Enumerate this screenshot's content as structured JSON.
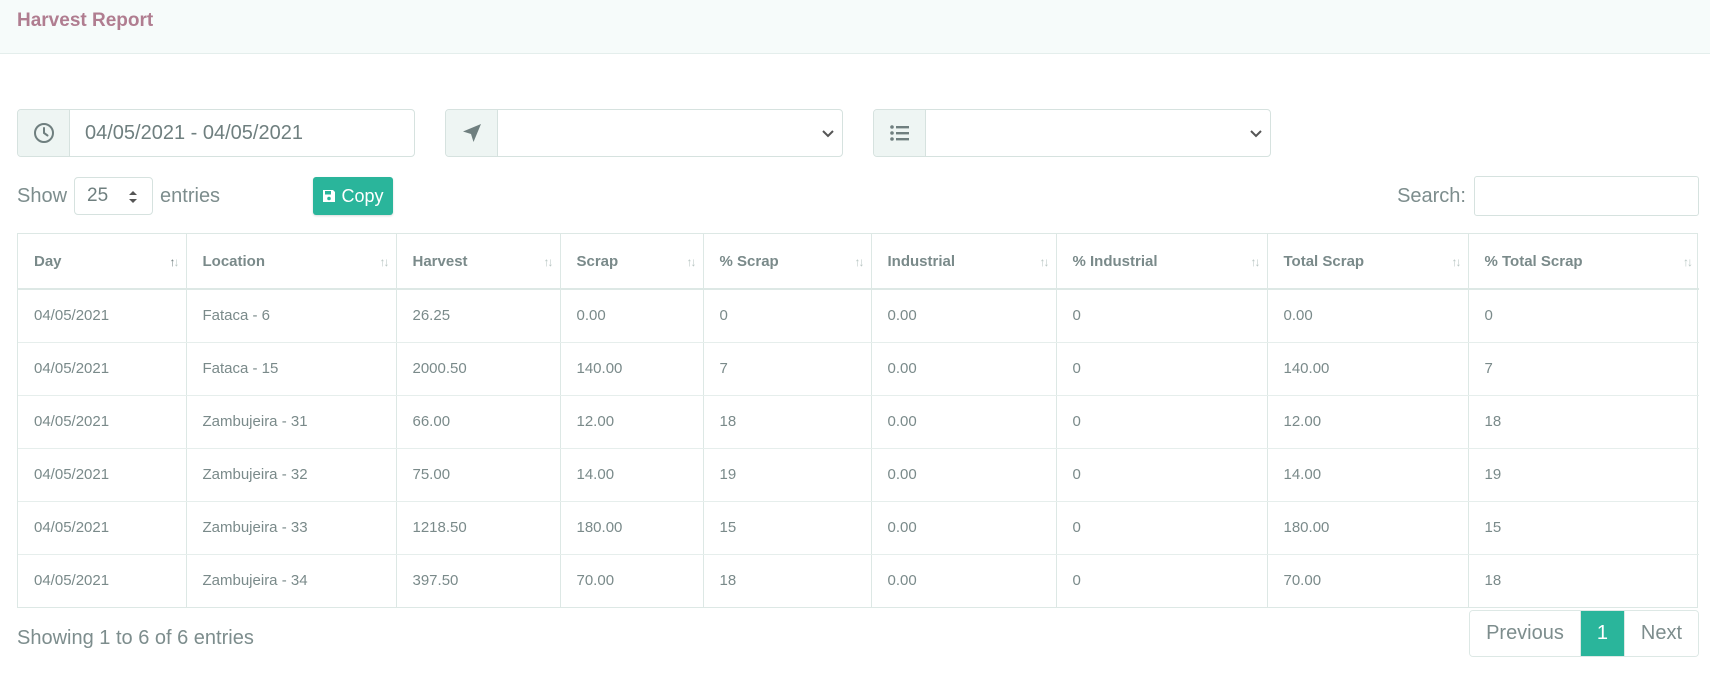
{
  "page": {
    "title": "Harvest Report"
  },
  "filters": {
    "date_range": "04/05/2021 - 04/05/2021",
    "location_value": "",
    "category_value": ""
  },
  "controls": {
    "show_label": "Show",
    "entries_label": "entries",
    "page_length": "25",
    "copy_label": "Copy",
    "search_label": "Search:",
    "search_value": ""
  },
  "table": {
    "columns": [
      "Day",
      "Location",
      "Harvest",
      "Scrap",
      "% Scrap",
      "Industrial",
      "% Industrial",
      "Total Scrap",
      "% Total Scrap"
    ],
    "rows": [
      [
        "04/05/2021",
        "Fataca - 6",
        "26.25",
        "0.00",
        "0",
        "0.00",
        "0",
        "0.00",
        "0"
      ],
      [
        "04/05/2021",
        "Fataca - 15",
        "2000.50",
        "140.00",
        "7",
        "0.00",
        "0",
        "140.00",
        "7"
      ],
      [
        "04/05/2021",
        "Zambujeira - 31",
        "66.00",
        "12.00",
        "18",
        "0.00",
        "0",
        "12.00",
        "18"
      ],
      [
        "04/05/2021",
        "Zambujeira - 32",
        "75.00",
        "14.00",
        "19",
        "0.00",
        "0",
        "14.00",
        "19"
      ],
      [
        "04/05/2021",
        "Zambujeira - 33",
        "1218.50",
        "180.00",
        "15",
        "0.00",
        "0",
        "180.00",
        "15"
      ],
      [
        "04/05/2021",
        "Zambujeira - 34",
        "397.50",
        "70.00",
        "18",
        "0.00",
        "0",
        "70.00",
        "18"
      ]
    ]
  },
  "footer": {
    "info": "Showing 1 to 6 of 6 entries",
    "previous_label": "Previous",
    "current_page": "1",
    "next_label": "Next"
  },
  "icons": {
    "date": "clock-icon",
    "location": "location-arrow-icon",
    "category": "list-icon",
    "copy": "save-icon"
  },
  "colors": {
    "accent": "#2ab59b",
    "title": "#b07d90"
  }
}
